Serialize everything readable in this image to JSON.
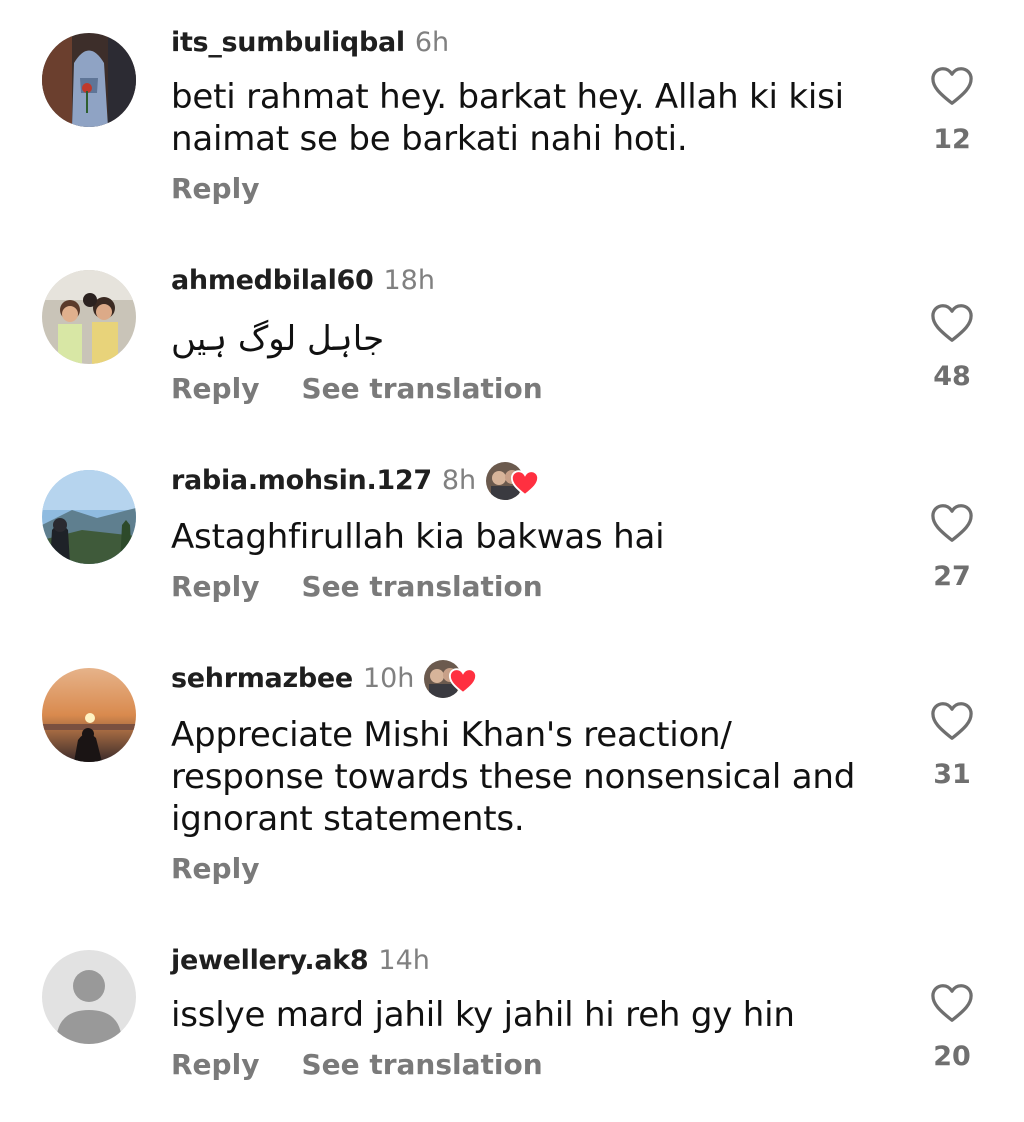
{
  "comments": [
    {
      "username": "its_sumbuliqbal",
      "time": "6h",
      "text": "beti rahmat hey. barkat hey. Allah ki kisi naimat se be barkati nahi hoti.",
      "reply_label": "Reply",
      "like_count": "12",
      "avatar_icon": "avatar-veiled-person-photo"
    },
    {
      "username": "ahmedbilal60",
      "time": "18h",
      "text": "جاہل لوگ ہیں",
      "reply_label": "Reply",
      "translate_label": "See translation",
      "like_count": "48",
      "avatar_icon": "avatar-children-photo"
    },
    {
      "username": "rabia.mohsin.127",
      "time": "8h",
      "text": "Astaghfirullah kia bakwas hai",
      "reply_label": "Reply",
      "translate_label": "See translation",
      "like_count": "27",
      "avatar_icon": "avatar-mountain-landscape-photo",
      "creator_liked": true
    },
    {
      "username": "sehrmazbee",
      "time": "10h",
      "text": "Appreciate Mishi Khan's reaction/ response towards these nonsensical and ignorant statements.",
      "reply_label": "Reply",
      "like_count": "31",
      "avatar_icon": "avatar-sunset-silhouette-photo",
      "creator_liked": true
    },
    {
      "username": "jewellery.ak8",
      "time": "14h",
      "text": "isslye mard jahil ky jahil hi reh gy hin",
      "reply_label": "Reply",
      "translate_label": "See translation",
      "like_count": "20",
      "avatar_icon": "default-avatar-icon"
    }
  ],
  "colors": {
    "text": "#111111",
    "secondary": "#808080",
    "heart_red": "#ff3040"
  }
}
